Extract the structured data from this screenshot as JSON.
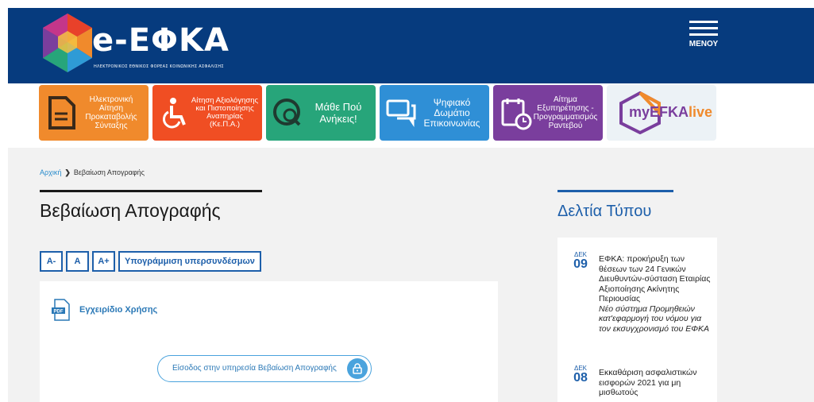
{
  "header": {
    "logo_text": "e-ΕΦΚΑ",
    "logo_subtitle": "ΗΛΕΚΤΡΟΝΙΚΟΣ ΕΘΝΙΚΟΣ ΦΟΡΕΑΣ ΚΟΙΝΩΝΙΚΗΣ ΑΣΦΑΛΙΣΗΣ",
    "menu_label": "ΜΕΝΟΥ",
    "background": "#063b7e"
  },
  "tiles": [
    {
      "label": "Ηλεκτρονική Αίτηση Προκαταβολής Σύνταξης",
      "icon": "document-icon",
      "color": "#f08a2c"
    },
    {
      "label": "Αίτηση Αξιολόγησης και Πιστοποίησης Αναπηρίας (Κε.Π.Α.)",
      "icon": "wheelchair-icon",
      "color": "#f04e23"
    },
    {
      "label": "Μάθε Πού Ανήκεις!",
      "icon": "globe-search-icon",
      "color": "#27a57a"
    },
    {
      "label": "Ψηφιακό Δωμάτιο Επικοινωνίας",
      "icon": "chat-bubbles-icon",
      "color": "#2f8fd6"
    },
    {
      "label": "Αίτημα Εξυπηρέτησης - Προγραμματισμός Ραντεβού",
      "icon": "calendar-clock-icon",
      "color": "#7a3e9d"
    },
    {
      "label_main": "myEFKA",
      "label_accent": "live",
      "icon": "hexagon-icon",
      "color": "#ecf2f6"
    }
  ],
  "breadcrumb": {
    "home": "Αρχική",
    "separator": "❯",
    "current": "Βεβαίωση Απογραφής"
  },
  "page_title": "Βεβαίωση Απογραφής",
  "font_controls": {
    "decrease": "A-",
    "normal": "A",
    "increase": "A+",
    "underline_links": "Υπογράμμιση υπερσυνδέσμων"
  },
  "card": {
    "manual_label": "Εγχειρίδιο Χρήσης",
    "enter_button": "Είσοδος στην υπηρεσία Βεβαίωση Απογραφής"
  },
  "press": {
    "title": "Δελτία Τύπου",
    "items": [
      {
        "month": "ΔΕΚ",
        "day": "09",
        "text": "ΕΦΚΑ: προκήρυξη των θέσεων των 24 Γενικών Διευθυντών-σύσταση Εταιρίας Αξιοποίησης Ακίνητης Περιουσίας",
        "italic": "Νέο σύστημα Προμηθειών κατ'εφαρμογή του νόμου για τον εκσυγχρονισμό του ΕΦΚΑ"
      },
      {
        "month": "ΔΕΚ",
        "day": "08",
        "text": "Εκκαθάριση ασφαλιστικών εισφορών 2021 για μη μισθωτούς",
        "italic": ""
      }
    ]
  }
}
